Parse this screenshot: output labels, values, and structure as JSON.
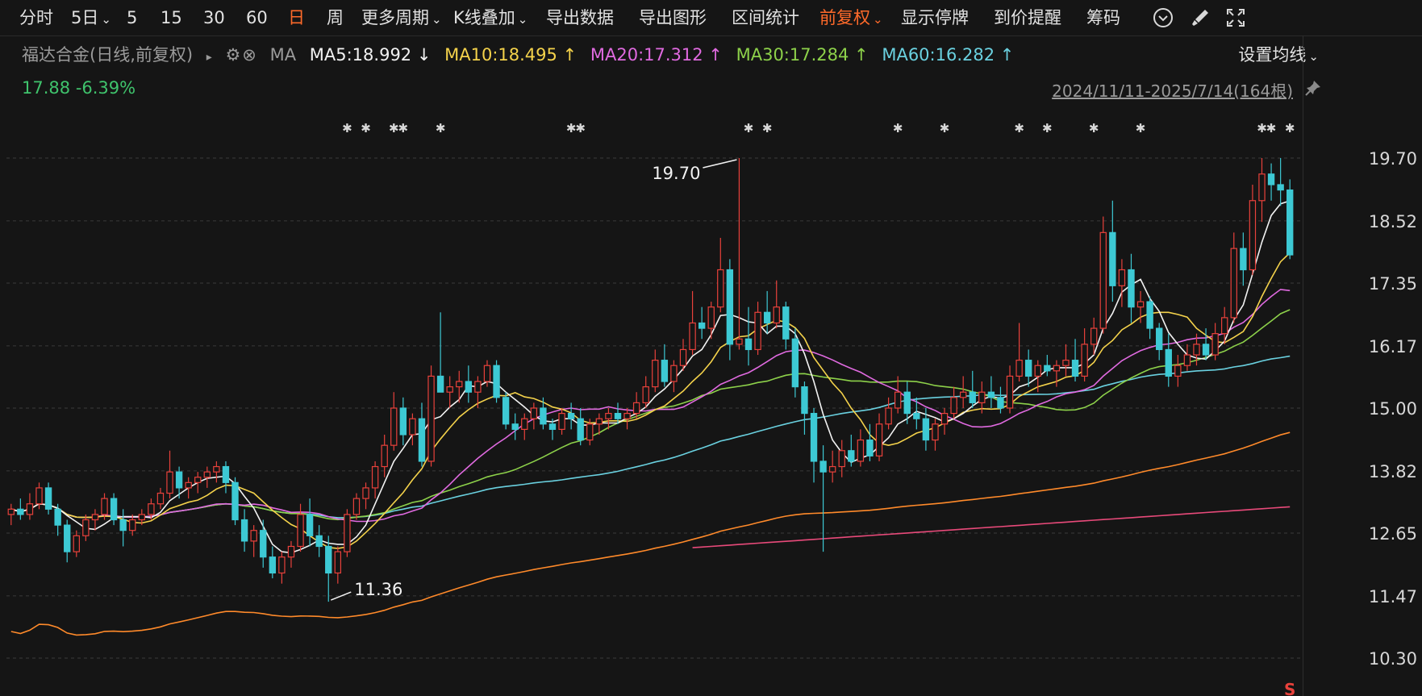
{
  "toolbar": {
    "items": [
      {
        "label": "分时"
      },
      {
        "label": "5日",
        "dropdown": true
      },
      {
        "label": "5"
      },
      {
        "label": "15"
      },
      {
        "label": "30"
      },
      {
        "label": "60"
      },
      {
        "label": "日",
        "active": true
      },
      {
        "label": "周"
      },
      {
        "label": "更多周期",
        "dropdown": true
      },
      {
        "label": "K线叠加",
        "dropdown": true
      },
      {
        "label": "导出数据"
      },
      {
        "label": "导出图形"
      },
      {
        "label": "区间统计"
      },
      {
        "label": "前复权",
        "dropdown": true,
        "active": true
      },
      {
        "label": "显示停牌"
      },
      {
        "label": "到价提醒"
      },
      {
        "label": "筹码"
      }
    ],
    "icons": [
      "chevron-circle-icon",
      "brush-icon",
      "fullscreen-icon"
    ]
  },
  "legend": {
    "title": "福达合金(日线,前复权)",
    "ma_label": "MA",
    "ma5": "MA5:18.992 ↓",
    "ma10": "MA10:18.495 ↑",
    "ma20": "MA20:17.312 ↑",
    "ma30": "MA30:17.284 ↑",
    "ma60": "MA60:16.282 ↑",
    "set_ma": "设置均线"
  },
  "price": {
    "last": "17.88",
    "change": "-6.39%"
  },
  "range": {
    "label": "2024/11/11-2025/7/14(164根)"
  },
  "colors": {
    "up": "#e8413b",
    "down": "#3dc9d4",
    "ma5": "#f2f2f2",
    "ma10": "#f4d24b",
    "ma20": "#e06ae0",
    "ma30": "#8dd14a",
    "ma60": "#6ad1e0",
    "ma120": "#ff8a2a",
    "ma250": "#e84a7a",
    "accent": "#ff6a2a"
  },
  "chart_data": {
    "type": "candlestick",
    "y_ticks": [
      "19.70",
      "18.52",
      "17.35",
      "16.17",
      "15.00",
      "13.82",
      "12.65",
      "11.47",
      "10.30"
    ],
    "ylim": [
      10.3,
      19.7
    ],
    "annotations": {
      "high": "19.70",
      "low": "11.36"
    },
    "marker": "S",
    "candles": [
      {
        "o": 13.0,
        "h": 13.2,
        "l": 12.8,
        "c": 13.1
      },
      {
        "o": 13.1,
        "h": 13.3,
        "l": 12.9,
        "c": 13.0
      },
      {
        "o": 13.0,
        "h": 13.4,
        "l": 12.9,
        "c": 13.2
      },
      {
        "o": 13.2,
        "h": 13.6,
        "l": 13.1,
        "c": 13.5
      },
      {
        "o": 13.5,
        "h": 13.6,
        "l": 13.0,
        "c": 13.1
      },
      {
        "o": 13.1,
        "h": 13.2,
        "l": 12.6,
        "c": 12.8
      },
      {
        "o": 12.8,
        "h": 12.9,
        "l": 12.1,
        "c": 12.3
      },
      {
        "o": 12.3,
        "h": 12.7,
        "l": 12.2,
        "c": 12.6
      },
      {
        "o": 12.6,
        "h": 13.0,
        "l": 12.5,
        "c": 12.9
      },
      {
        "o": 12.9,
        "h": 13.1,
        "l": 12.7,
        "c": 13.0
      },
      {
        "o": 13.0,
        "h": 13.4,
        "l": 12.9,
        "c": 13.3
      },
      {
        "o": 13.3,
        "h": 13.4,
        "l": 12.8,
        "c": 12.9
      },
      {
        "o": 12.9,
        "h": 13.1,
        "l": 12.4,
        "c": 12.7
      },
      {
        "o": 12.7,
        "h": 13.0,
        "l": 12.6,
        "c": 12.9
      },
      {
        "o": 12.9,
        "h": 13.1,
        "l": 12.8,
        "c": 13.0
      },
      {
        "o": 13.0,
        "h": 13.3,
        "l": 12.9,
        "c": 13.2
      },
      {
        "o": 13.2,
        "h": 13.5,
        "l": 13.1,
        "c": 13.4
      },
      {
        "o": 13.4,
        "h": 14.2,
        "l": 13.3,
        "c": 13.8
      },
      {
        "o": 13.8,
        "h": 13.9,
        "l": 13.3,
        "c": 13.5
      },
      {
        "o": 13.5,
        "h": 13.7,
        "l": 13.3,
        "c": 13.6
      },
      {
        "o": 13.6,
        "h": 13.8,
        "l": 13.4,
        "c": 13.7
      },
      {
        "o": 13.7,
        "h": 13.9,
        "l": 13.5,
        "c": 13.8
      },
      {
        "o": 13.8,
        "h": 14.0,
        "l": 13.6,
        "c": 13.9
      },
      {
        "o": 13.9,
        "h": 14.0,
        "l": 13.4,
        "c": 13.6
      },
      {
        "o": 13.6,
        "h": 13.7,
        "l": 12.8,
        "c": 12.9
      },
      {
        "o": 12.9,
        "h": 13.1,
        "l": 12.3,
        "c": 12.5
      },
      {
        "o": 12.5,
        "h": 12.8,
        "l": 12.2,
        "c": 12.7
      },
      {
        "o": 12.7,
        "h": 12.9,
        "l": 12.0,
        "c": 12.2
      },
      {
        "o": 12.2,
        "h": 12.4,
        "l": 11.8,
        "c": 11.9
      },
      {
        "o": 11.9,
        "h": 12.3,
        "l": 11.7,
        "c": 12.2
      },
      {
        "o": 12.2,
        "h": 12.5,
        "l": 12.0,
        "c": 12.4
      },
      {
        "o": 12.4,
        "h": 13.2,
        "l": 12.3,
        "c": 13.0
      },
      {
        "o": 13.0,
        "h": 13.3,
        "l": 12.4,
        "c": 12.6
      },
      {
        "o": 12.6,
        "h": 12.8,
        "l": 12.2,
        "c": 12.4
      },
      {
        "o": 12.4,
        "h": 12.6,
        "l": 11.36,
        "c": 11.9
      },
      {
        "o": 11.9,
        "h": 12.4,
        "l": 11.7,
        "c": 12.3
      },
      {
        "o": 12.3,
        "h": 13.1,
        "l": 12.2,
        "c": 13.0
      },
      {
        "o": 13.0,
        "h": 13.4,
        "l": 12.9,
        "c": 13.3
      },
      {
        "o": 13.3,
        "h": 13.6,
        "l": 13.1,
        "c": 13.5
      },
      {
        "o": 13.5,
        "h": 14.0,
        "l": 13.3,
        "c": 13.9
      },
      {
        "o": 13.9,
        "h": 14.5,
        "l": 13.7,
        "c": 14.3
      },
      {
        "o": 14.3,
        "h": 15.3,
        "l": 14.2,
        "c": 15.0
      },
      {
        "o": 15.0,
        "h": 15.2,
        "l": 14.3,
        "c": 14.5
      },
      {
        "o": 14.5,
        "h": 14.9,
        "l": 14.3,
        "c": 14.8
      },
      {
        "o": 14.8,
        "h": 15.1,
        "l": 13.9,
        "c": 14.0
      },
      {
        "o": 14.0,
        "h": 15.8,
        "l": 13.9,
        "c": 15.6
      },
      {
        "o": 15.6,
        "h": 16.8,
        "l": 15.3,
        "c": 15.3
      },
      {
        "o": 15.3,
        "h": 15.6,
        "l": 15.0,
        "c": 15.4
      },
      {
        "o": 15.4,
        "h": 15.7,
        "l": 15.1,
        "c": 15.5
      },
      {
        "o": 15.5,
        "h": 15.8,
        "l": 15.1,
        "c": 15.3
      },
      {
        "o": 15.3,
        "h": 15.6,
        "l": 15.0,
        "c": 15.5
      },
      {
        "o": 15.5,
        "h": 15.9,
        "l": 15.4,
        "c": 15.8
      },
      {
        "o": 15.8,
        "h": 15.9,
        "l": 15.1,
        "c": 15.2
      },
      {
        "o": 15.2,
        "h": 15.3,
        "l": 14.6,
        "c": 14.7
      },
      {
        "o": 14.7,
        "h": 14.9,
        "l": 14.4,
        "c": 14.6
      },
      {
        "o": 14.6,
        "h": 14.9,
        "l": 14.4,
        "c": 14.8
      },
      {
        "o": 14.8,
        "h": 15.1,
        "l": 14.6,
        "c": 15.0
      },
      {
        "o": 15.0,
        "h": 15.2,
        "l": 14.6,
        "c": 14.7
      },
      {
        "o": 14.7,
        "h": 14.8,
        "l": 14.4,
        "c": 14.6
      },
      {
        "o": 14.6,
        "h": 15.0,
        "l": 14.5,
        "c": 14.9
      },
      {
        "o": 14.9,
        "h": 15.1,
        "l": 14.6,
        "c": 14.8
      },
      {
        "o": 14.8,
        "h": 15.0,
        "l": 14.3,
        "c": 14.4
      },
      {
        "o": 14.4,
        "h": 14.8,
        "l": 14.3,
        "c": 14.7
      },
      {
        "o": 14.7,
        "h": 14.9,
        "l": 14.5,
        "c": 14.8
      },
      {
        "o": 14.8,
        "h": 15.0,
        "l": 14.6,
        "c": 14.9
      },
      {
        "o": 14.9,
        "h": 15.1,
        "l": 14.7,
        "c": 14.8
      },
      {
        "o": 14.8,
        "h": 15.0,
        "l": 14.6,
        "c": 14.9
      },
      {
        "o": 14.9,
        "h": 15.3,
        "l": 14.8,
        "c": 15.1
      },
      {
        "o": 15.1,
        "h": 15.6,
        "l": 15.0,
        "c": 15.4
      },
      {
        "o": 15.4,
        "h": 16.1,
        "l": 15.3,
        "c": 15.9
      },
      {
        "o": 15.9,
        "h": 16.2,
        "l": 15.4,
        "c": 15.5
      },
      {
        "o": 15.5,
        "h": 15.9,
        "l": 15.3,
        "c": 15.8
      },
      {
        "o": 15.8,
        "h": 16.3,
        "l": 15.7,
        "c": 16.1
      },
      {
        "o": 16.1,
        "h": 17.2,
        "l": 16.0,
        "c": 16.6
      },
      {
        "o": 16.6,
        "h": 16.9,
        "l": 16.3,
        "c": 16.5
      },
      {
        "o": 16.5,
        "h": 17.0,
        "l": 16.3,
        "c": 16.9
      },
      {
        "o": 16.9,
        "h": 18.2,
        "l": 16.8,
        "c": 17.6
      },
      {
        "o": 17.6,
        "h": 17.8,
        "l": 15.9,
        "c": 16.2
      },
      {
        "o": 16.2,
        "h": 19.7,
        "l": 16.1,
        "c": 16.3
      },
      {
        "o": 16.3,
        "h": 16.9,
        "l": 15.8,
        "c": 16.1
      },
      {
        "o": 16.1,
        "h": 17.0,
        "l": 16.0,
        "c": 16.8
      },
      {
        "o": 16.8,
        "h": 17.2,
        "l": 16.4,
        "c": 16.6
      },
      {
        "o": 16.6,
        "h": 17.4,
        "l": 16.5,
        "c": 16.9
      },
      {
        "o": 16.9,
        "h": 17.0,
        "l": 16.1,
        "c": 16.3
      },
      {
        "o": 16.3,
        "h": 16.5,
        "l": 15.2,
        "c": 15.4
      },
      {
        "o": 15.4,
        "h": 15.5,
        "l": 14.5,
        "c": 14.9
      },
      {
        "o": 14.9,
        "h": 15.0,
        "l": 13.6,
        "c": 14.0
      },
      {
        "o": 14.0,
        "h": 14.3,
        "l": 12.3,
        "c": 13.8
      },
      {
        "o": 13.8,
        "h": 14.2,
        "l": 13.6,
        "c": 13.9
      },
      {
        "o": 13.9,
        "h": 14.4,
        "l": 13.7,
        "c": 14.2
      },
      {
        "o": 14.2,
        "h": 14.5,
        "l": 13.9,
        "c": 14.0
      },
      {
        "o": 14.0,
        "h": 14.6,
        "l": 13.9,
        "c": 14.4
      },
      {
        "o": 14.4,
        "h": 14.7,
        "l": 14.0,
        "c": 14.1
      },
      {
        "o": 14.1,
        "h": 14.9,
        "l": 14.0,
        "c": 14.7
      },
      {
        "o": 14.7,
        "h": 15.2,
        "l": 14.6,
        "c": 15.0
      },
      {
        "o": 15.0,
        "h": 15.6,
        "l": 14.9,
        "c": 15.3
      },
      {
        "o": 15.3,
        "h": 15.5,
        "l": 14.7,
        "c": 14.9
      },
      {
        "o": 14.9,
        "h": 15.2,
        "l": 14.6,
        "c": 14.8
      },
      {
        "o": 14.8,
        "h": 15.0,
        "l": 14.2,
        "c": 14.4
      },
      {
        "o": 14.4,
        "h": 14.8,
        "l": 14.2,
        "c": 14.7
      },
      {
        "o": 14.7,
        "h": 15.0,
        "l": 14.5,
        "c": 14.9
      },
      {
        "o": 14.9,
        "h": 15.4,
        "l": 14.8,
        "c": 15.2
      },
      {
        "o": 15.2,
        "h": 15.6,
        "l": 15.0,
        "c": 15.3
      },
      {
        "o": 15.3,
        "h": 15.7,
        "l": 15.0,
        "c": 15.1
      },
      {
        "o": 15.1,
        "h": 15.5,
        "l": 14.9,
        "c": 15.3
      },
      {
        "o": 15.3,
        "h": 15.6,
        "l": 15.0,
        "c": 15.2
      },
      {
        "o": 15.2,
        "h": 15.4,
        "l": 14.9,
        "c": 15.0
      },
      {
        "o": 15.0,
        "h": 15.8,
        "l": 14.9,
        "c": 15.6
      },
      {
        "o": 15.6,
        "h": 16.6,
        "l": 15.5,
        "c": 15.9
      },
      {
        "o": 15.9,
        "h": 16.1,
        "l": 15.4,
        "c": 15.6
      },
      {
        "o": 15.6,
        "h": 15.9,
        "l": 15.3,
        "c": 15.8
      },
      {
        "o": 15.8,
        "h": 16.0,
        "l": 15.6,
        "c": 15.7
      },
      {
        "o": 15.7,
        "h": 15.9,
        "l": 15.4,
        "c": 15.8
      },
      {
        "o": 15.8,
        "h": 16.2,
        "l": 15.6,
        "c": 15.9
      },
      {
        "o": 15.9,
        "h": 16.3,
        "l": 15.5,
        "c": 15.6
      },
      {
        "o": 15.6,
        "h": 16.5,
        "l": 15.5,
        "c": 16.2
      },
      {
        "o": 16.2,
        "h": 16.7,
        "l": 16.0,
        "c": 16.5
      },
      {
        "o": 16.5,
        "h": 18.6,
        "l": 16.4,
        "c": 18.3
      },
      {
        "o": 18.3,
        "h": 18.9,
        "l": 17.0,
        "c": 17.3
      },
      {
        "o": 17.3,
        "h": 17.8,
        "l": 16.9,
        "c": 17.6
      },
      {
        "o": 17.6,
        "h": 17.9,
        "l": 16.6,
        "c": 16.9
      },
      {
        "o": 16.9,
        "h": 17.2,
        "l": 16.6,
        "c": 17.0
      },
      {
        "o": 17.0,
        "h": 17.1,
        "l": 16.3,
        "c": 16.5
      },
      {
        "o": 16.5,
        "h": 16.6,
        "l": 15.9,
        "c": 16.1
      },
      {
        "o": 16.1,
        "h": 16.4,
        "l": 15.4,
        "c": 15.6
      },
      {
        "o": 15.6,
        "h": 16.0,
        "l": 15.4,
        "c": 15.8
      },
      {
        "o": 15.8,
        "h": 16.2,
        "l": 15.7,
        "c": 16.0
      },
      {
        "o": 16.0,
        "h": 16.4,
        "l": 15.8,
        "c": 16.2
      },
      {
        "o": 16.2,
        "h": 16.5,
        "l": 15.9,
        "c": 16.0
      },
      {
        "o": 16.0,
        "h": 16.6,
        "l": 15.9,
        "c": 16.4
      },
      {
        "o": 16.4,
        "h": 16.9,
        "l": 16.2,
        "c": 16.7
      },
      {
        "o": 16.7,
        "h": 18.3,
        "l": 16.6,
        "c": 18.0
      },
      {
        "o": 18.0,
        "h": 18.3,
        "l": 17.3,
        "c": 17.6
      },
      {
        "o": 17.6,
        "h": 19.2,
        "l": 17.5,
        "c": 18.9
      },
      {
        "o": 18.9,
        "h": 19.7,
        "l": 18.5,
        "c": 19.4
      },
      {
        "o": 19.4,
        "h": 19.6,
        "l": 18.9,
        "c": 19.2
      },
      {
        "o": 19.2,
        "h": 19.7,
        "l": 18.8,
        "c": 19.1
      },
      {
        "o": 19.1,
        "h": 19.3,
        "l": 17.8,
        "c": 17.88
      }
    ]
  }
}
